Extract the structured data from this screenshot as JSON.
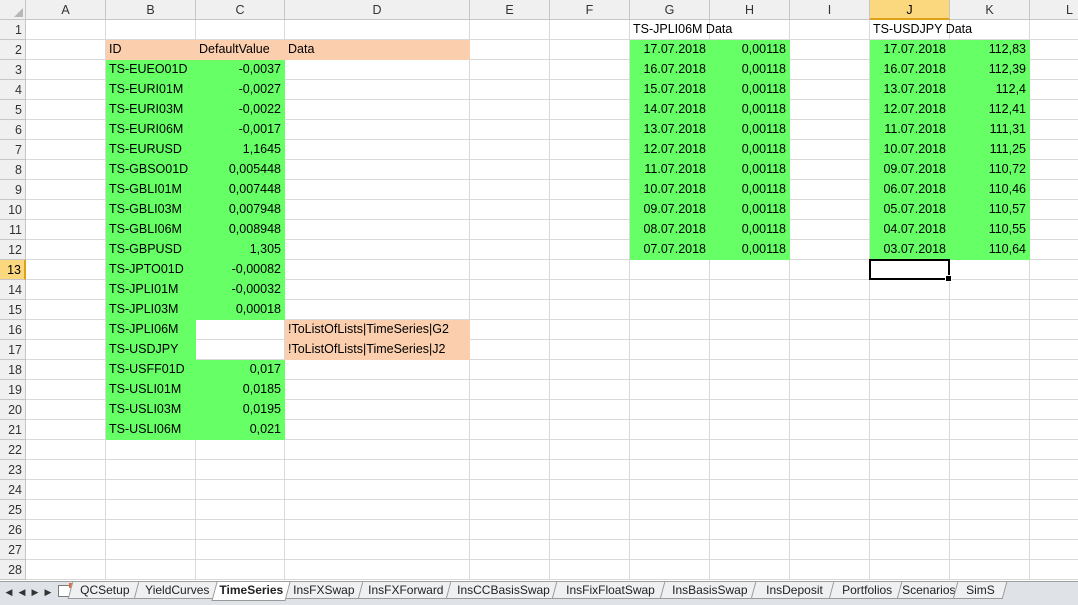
{
  "columns": [
    "A",
    "B",
    "C",
    "D",
    "E",
    "F",
    "G",
    "H",
    "I",
    "J",
    "K",
    "L"
  ],
  "rows": [
    "1",
    "2",
    "3",
    "4",
    "5",
    "6",
    "7",
    "8",
    "9",
    "10",
    "11",
    "12",
    "13",
    "14",
    "15",
    "16",
    "17",
    "18",
    "19",
    "20",
    "21",
    "22",
    "23",
    "24",
    "25",
    "26",
    "27",
    "28"
  ],
  "selected_column": "J",
  "selected_row": "13",
  "cells": [
    {
      "ref": "G1",
      "text": "TS-JPLI06M Data"
    },
    {
      "ref": "J1",
      "text": "TS-USDJPY Data"
    },
    {
      "ref": "B2",
      "text": "ID",
      "fill": "peach"
    },
    {
      "ref": "C2",
      "text": "DefaultValue",
      "fill": "peach"
    },
    {
      "ref": "D2",
      "text": "Data",
      "fill": "peach"
    },
    {
      "ref": "B3",
      "text": "TS-EUEO01D",
      "fill": "green"
    },
    {
      "ref": "C3",
      "text": "-0,0037",
      "fill": "green",
      "num": true
    },
    {
      "ref": "B4",
      "text": "TS-EURI01M",
      "fill": "green"
    },
    {
      "ref": "C4",
      "text": "-0,0027",
      "fill": "green",
      "num": true
    },
    {
      "ref": "B5",
      "text": "TS-EURI03M",
      "fill": "green"
    },
    {
      "ref": "C5",
      "text": "-0,0022",
      "fill": "green",
      "num": true
    },
    {
      "ref": "B6",
      "text": "TS-EURI06M",
      "fill": "green"
    },
    {
      "ref": "C6",
      "text": "-0,0017",
      "fill": "green",
      "num": true
    },
    {
      "ref": "B7",
      "text": "TS-EURUSD",
      "fill": "green"
    },
    {
      "ref": "C7",
      "text": "1,1645",
      "fill": "green",
      "num": true
    },
    {
      "ref": "B8",
      "text": "TS-GBSO01D",
      "fill": "green"
    },
    {
      "ref": "C8",
      "text": "0,005448",
      "fill": "green",
      "num": true
    },
    {
      "ref": "B9",
      "text": "TS-GBLI01M",
      "fill": "green"
    },
    {
      "ref": "C9",
      "text": "0,007448",
      "fill": "green",
      "num": true
    },
    {
      "ref": "B10",
      "text": "TS-GBLI03M",
      "fill": "green"
    },
    {
      "ref": "C10",
      "text": "0,007948",
      "fill": "green",
      "num": true
    },
    {
      "ref": "B11",
      "text": "TS-GBLI06M",
      "fill": "green"
    },
    {
      "ref": "C11",
      "text": "0,008948",
      "fill": "green",
      "num": true
    },
    {
      "ref": "B12",
      "text": "TS-GBPUSD",
      "fill": "green"
    },
    {
      "ref": "C12",
      "text": "1,305",
      "fill": "green",
      "num": true
    },
    {
      "ref": "B13",
      "text": "TS-JPTO01D",
      "fill": "green"
    },
    {
      "ref": "C13",
      "text": "-0,00082",
      "fill": "green",
      "num": true
    },
    {
      "ref": "B14",
      "text": "TS-JPLI01M",
      "fill": "green"
    },
    {
      "ref": "C14",
      "text": "-0,00032",
      "fill": "green",
      "num": true
    },
    {
      "ref": "B15",
      "text": "TS-JPLI03M",
      "fill": "green"
    },
    {
      "ref": "C15",
      "text": "0,00018",
      "fill": "green",
      "num": true
    },
    {
      "ref": "B16",
      "text": "TS-JPLI06M",
      "fill": "green"
    },
    {
      "ref": "D16",
      "text": "!ToListOfLists|TimeSeries|G2",
      "fill": "peach"
    },
    {
      "ref": "B17",
      "text": "TS-USDJPY",
      "fill": "green"
    },
    {
      "ref": "D17",
      "text": "!ToListOfLists|TimeSeries|J2",
      "fill": "peach"
    },
    {
      "ref": "B18",
      "text": "TS-USFF01D",
      "fill": "green"
    },
    {
      "ref": "C18",
      "text": "0,017",
      "fill": "green",
      "num": true
    },
    {
      "ref": "B19",
      "text": "TS-USLI01M",
      "fill": "green"
    },
    {
      "ref": "C19",
      "text": "0,0185",
      "fill": "green",
      "num": true
    },
    {
      "ref": "B20",
      "text": "TS-USLI03M",
      "fill": "green"
    },
    {
      "ref": "C20",
      "text": "0,0195",
      "fill": "green",
      "num": true
    },
    {
      "ref": "B21",
      "text": "TS-USLI06M",
      "fill": "green"
    },
    {
      "ref": "C21",
      "text": "0,021",
      "fill": "green",
      "num": true
    },
    {
      "ref": "G2",
      "text": "17.07.2018",
      "fill": "green",
      "num": true
    },
    {
      "ref": "H2",
      "text": "0,00118",
      "fill": "green",
      "num": true
    },
    {
      "ref": "G3",
      "text": "16.07.2018",
      "fill": "green",
      "num": true
    },
    {
      "ref": "H3",
      "text": "0,00118",
      "fill": "green",
      "num": true
    },
    {
      "ref": "G4",
      "text": "15.07.2018",
      "fill": "green",
      "num": true
    },
    {
      "ref": "H4",
      "text": "0,00118",
      "fill": "green",
      "num": true
    },
    {
      "ref": "G5",
      "text": "14.07.2018",
      "fill": "green",
      "num": true
    },
    {
      "ref": "H5",
      "text": "0,00118",
      "fill": "green",
      "num": true
    },
    {
      "ref": "G6",
      "text": "13.07.2018",
      "fill": "green",
      "num": true
    },
    {
      "ref": "H6",
      "text": "0,00118",
      "fill": "green",
      "num": true
    },
    {
      "ref": "G7",
      "text": "12.07.2018",
      "fill": "green",
      "num": true
    },
    {
      "ref": "H7",
      "text": "0,00118",
      "fill": "green",
      "num": true
    },
    {
      "ref": "G8",
      "text": "11.07.2018",
      "fill": "green",
      "num": true
    },
    {
      "ref": "H8",
      "text": "0,00118",
      "fill": "green",
      "num": true
    },
    {
      "ref": "G9",
      "text": "10.07.2018",
      "fill": "green",
      "num": true
    },
    {
      "ref": "H9",
      "text": "0,00118",
      "fill": "green",
      "num": true
    },
    {
      "ref": "G10",
      "text": "09.07.2018",
      "fill": "green",
      "num": true
    },
    {
      "ref": "H10",
      "text": "0,00118",
      "fill": "green",
      "num": true
    },
    {
      "ref": "G11",
      "text": "08.07.2018",
      "fill": "green",
      "num": true
    },
    {
      "ref": "H11",
      "text": "0,00118",
      "fill": "green",
      "num": true
    },
    {
      "ref": "G12",
      "text": "07.07.2018",
      "fill": "green",
      "num": true
    },
    {
      "ref": "H12",
      "text": "0,00118",
      "fill": "green",
      "num": true
    },
    {
      "ref": "J2",
      "text": "17.07.2018",
      "fill": "green",
      "num": true
    },
    {
      "ref": "K2",
      "text": "112,83",
      "fill": "green",
      "num": true
    },
    {
      "ref": "J3",
      "text": "16.07.2018",
      "fill": "green",
      "num": true
    },
    {
      "ref": "K3",
      "text": "112,39",
      "fill": "green",
      "num": true
    },
    {
      "ref": "J4",
      "text": "13.07.2018",
      "fill": "green",
      "num": true
    },
    {
      "ref": "K4",
      "text": "112,4",
      "fill": "green",
      "num": true
    },
    {
      "ref": "J5",
      "text": "12.07.2018",
      "fill": "green",
      "num": true
    },
    {
      "ref": "K5",
      "text": "112,41",
      "fill": "green",
      "num": true
    },
    {
      "ref": "J6",
      "text": "11.07.2018",
      "fill": "green",
      "num": true
    },
    {
      "ref": "K6",
      "text": "111,31",
      "fill": "green",
      "num": true
    },
    {
      "ref": "J7",
      "text": "10.07.2018",
      "fill": "green",
      "num": true
    },
    {
      "ref": "K7",
      "text": "111,25",
      "fill": "green",
      "num": true
    },
    {
      "ref": "J8",
      "text": "09.07.2018",
      "fill": "green",
      "num": true
    },
    {
      "ref": "K8",
      "text": "110,72",
      "fill": "green",
      "num": true
    },
    {
      "ref": "J9",
      "text": "06.07.2018",
      "fill": "green",
      "num": true
    },
    {
      "ref": "K9",
      "text": "110,46",
      "fill": "green",
      "num": true
    },
    {
      "ref": "J10",
      "text": "05.07.2018",
      "fill": "green",
      "num": true
    },
    {
      "ref": "K10",
      "text": "110,57",
      "fill": "green",
      "num": true
    },
    {
      "ref": "J11",
      "text": "04.07.2018",
      "fill": "green",
      "num": true
    },
    {
      "ref": "K11",
      "text": "110,55",
      "fill": "green",
      "num": true
    },
    {
      "ref": "J12",
      "text": "03.07.2018",
      "fill": "green",
      "num": true
    },
    {
      "ref": "K12",
      "text": "110,64",
      "fill": "green",
      "num": true
    }
  ],
  "active_cell": "J13",
  "colors": {
    "green": "#66ff66",
    "peach": "#fbcfae",
    "selected_header": "#fbd87d"
  },
  "sheet_tabs": [
    {
      "label": "QCSetup",
      "active": false
    },
    {
      "label": "YieldCurves",
      "active": false
    },
    {
      "label": "TimeSeries",
      "active": true
    },
    {
      "label": "InsFXSwap",
      "active": false
    },
    {
      "label": "InsFXForward",
      "active": false
    },
    {
      "label": "InsCCBasisSwap",
      "active": false
    },
    {
      "label": "InsFixFloatSwap",
      "active": false
    },
    {
      "label": "InsBasisSwap",
      "active": false
    },
    {
      "label": "InsDeposit",
      "active": false
    },
    {
      "label": "Portfolios",
      "active": false
    },
    {
      "label": "Scenarios",
      "active": false
    },
    {
      "label": "SimS",
      "active": false
    }
  ],
  "nav_icons": [
    "first-sheet-icon",
    "prev-sheet-icon",
    "next-sheet-icon",
    "last-sheet-icon"
  ]
}
